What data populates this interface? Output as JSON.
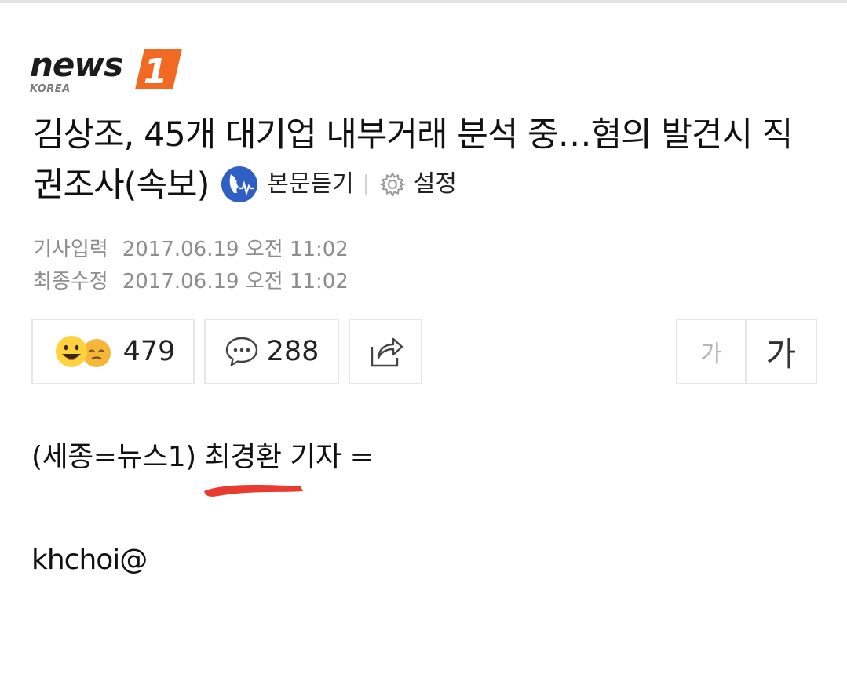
{
  "brand": {
    "wordmark": "news",
    "badge": "1",
    "subtitle": "KOREA",
    "colors": {
      "badge": "#f26a21",
      "wordmark": "#1c1c1c"
    }
  },
  "article": {
    "headline": "김상조, 45개 대기업 내부거래 분석 중…혐의 발견시 직권조사(속보)",
    "tools": {
      "tts_label": "본문듣기",
      "settings_label": "설정",
      "tts_icon": "speaker-face-icon",
      "settings_icon": "gear-icon"
    },
    "meta": {
      "input_label": "기사입력",
      "input_date": "2017.06.19 오전 11:02",
      "modified_label": "최종수정",
      "modified_date": "2017.06.19 오전 11:02"
    },
    "actions": {
      "reaction_count": "479",
      "comment_count": "288",
      "share_icon": "share-icon",
      "font_small_label": "가",
      "font_large_label": "가"
    },
    "byline": "(세종=뉴스1) 최경환 기자 =",
    "email": "khchoi@"
  }
}
